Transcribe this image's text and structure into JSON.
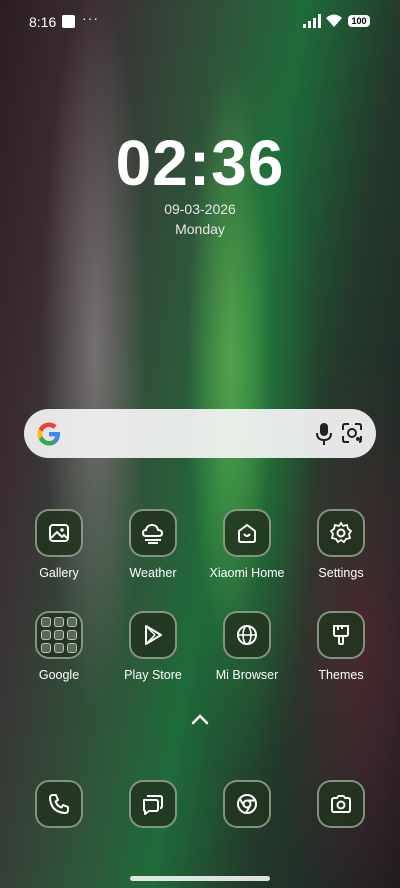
{
  "status_bar": {
    "time": "8:16",
    "dots": "···",
    "battery": "100"
  },
  "clock": {
    "time": "02:36",
    "date": "09-03-2026",
    "day": "Monday"
  },
  "search": {
    "logo": "google-logo",
    "mic": "mic-icon",
    "lens": "google-lens-icon"
  },
  "apps_row1": [
    {
      "label": "Gallery",
      "icon": "gallery-icon"
    },
    {
      "label": "Weather",
      "icon": "weather-icon"
    },
    {
      "label": "Xiaomi Home",
      "icon": "xiaomi-home-icon"
    },
    {
      "label": "Settings",
      "icon": "gear-icon"
    }
  ],
  "apps_row2": [
    {
      "label": "Google",
      "icon": "google-folder-icon"
    },
    {
      "label": "Play Store",
      "icon": "play-store-icon"
    },
    {
      "label": "Mi Browser",
      "icon": "globe-icon"
    },
    {
      "label": "Themes",
      "icon": "brush-icon"
    }
  ],
  "dock": [
    {
      "icon": "phone-icon"
    },
    {
      "icon": "messages-icon"
    },
    {
      "icon": "chrome-icon"
    },
    {
      "icon": "camera-icon"
    }
  ]
}
